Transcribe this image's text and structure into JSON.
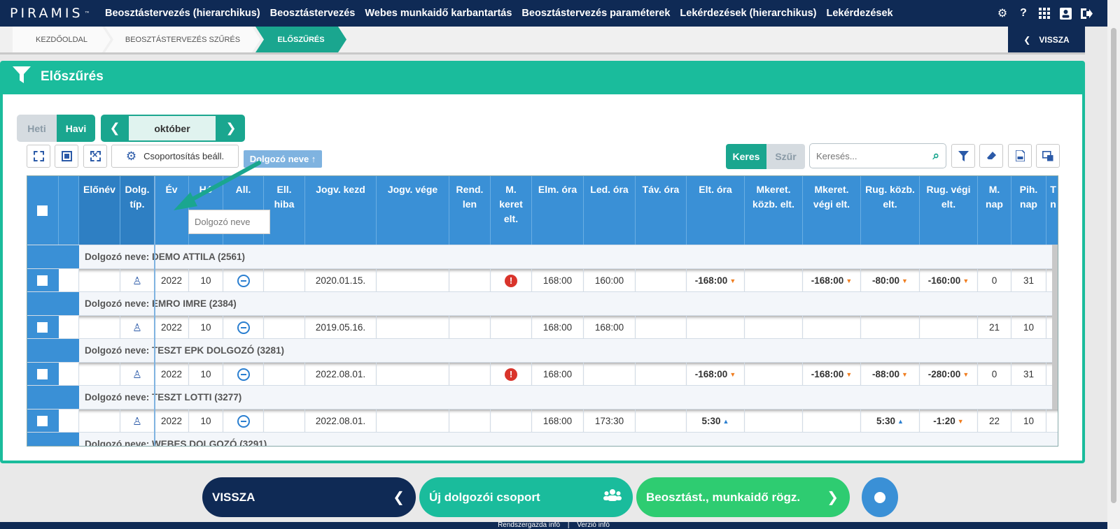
{
  "app": {
    "logo": "PIRAMIS",
    "logo_tm": "™"
  },
  "topnav": [
    "Beosztástervezés (hierarchikus)",
    "Beosztástervezés",
    "Webes munkaidő karbantartás",
    "Beosztástervezés paraméterek",
    "Lekérdezések (hierarchikus)",
    "Lekérdezések"
  ],
  "top_icons": [
    "gear-icon",
    "help-icon",
    "grid-icon",
    "user-card-icon",
    "logout-icon"
  ],
  "breadcrumb": {
    "items": [
      "KEZDŐOLDAL",
      "BEOSZTÁSTERVEZÉS SZŰRÉS",
      "ELŐSZŰRÉS"
    ],
    "back": "VISSZA"
  },
  "panel": {
    "title": "Előszűrés"
  },
  "view": {
    "weekly": "Heti",
    "monthly": "Havi",
    "month": "október"
  },
  "toolbar": {
    "grouping": "Csoportosítás beáll.",
    "drag_chip": "Dolgozó neve ↑",
    "search_btn": "Keres",
    "filter_btn": "Szűr",
    "search_placeholder": "Keresés..."
  },
  "drag_hint": "Dolgozó neve",
  "columns": [
    "Előnév",
    "Dolg. típ.",
    "Év",
    "Hó",
    "All.",
    "Ell. hiba",
    "Jogv. kezd",
    "Jogv. vége",
    "Rend. len",
    "M. keret elt.",
    "Elm. óra",
    "Led. óra",
    "Táv. óra",
    "Elt. óra",
    "Mkeret. közb. elt.",
    "Mkeret. végi elt.",
    "Rug. közb. elt.",
    "Rug. végi elt.",
    "M. nap",
    "Pih. nap",
    "T n"
  ],
  "groups": [
    {
      "label": "Dolgozó neve: DEMO ATTILA (2561)",
      "row": {
        "ev": "2022",
        "ho": "10",
        "jogv_kezd": "2020.01.15.",
        "m_keret": "error",
        "elm": "168:00",
        "led": "160:00",
        "elt": "-168:00",
        "elt_dir": "down",
        "mk_vegi": "-168:00",
        "rug_kozb": "-80:00",
        "rug_vegi": "-160:00",
        "m_nap": "0",
        "pih_nap": "31"
      }
    },
    {
      "label": "Dolgozó neve: EMRO IMRE (2384)",
      "row": {
        "ev": "2022",
        "ho": "10",
        "jogv_kezd": "2019.05.16.",
        "m_keret": "",
        "elm": "168:00",
        "led": "168:00",
        "elt": "",
        "elt_dir": "",
        "mk_vegi": "",
        "rug_kozb": "",
        "rug_vegi": "",
        "m_nap": "21",
        "pih_nap": "10"
      }
    },
    {
      "label": "Dolgozó neve: TESZT EPK DOLGOZÓ (3281)",
      "row": {
        "ev": "2022",
        "ho": "10",
        "jogv_kezd": "2022.08.01.",
        "m_keret": "error",
        "elm": "168:00",
        "led": "",
        "elt": "-168:00",
        "elt_dir": "down",
        "mk_vegi": "-168:00",
        "rug_kozb": "-88:00",
        "rug_vegi": "-280:00",
        "m_nap": "0",
        "pih_nap": "31"
      }
    },
    {
      "label": "Dolgozó neve: TESZT LOTTI (3277)",
      "row": {
        "ev": "2022",
        "ho": "10",
        "jogv_kezd": "2022.08.01.",
        "m_keret": "",
        "elm": "168:00",
        "led": "173:30",
        "elt": "5:30",
        "elt_dir": "up",
        "mk_vegi": "",
        "rug_kozb": "5:30",
        "rug_vegi": "-1:20",
        "m_nap": "22",
        "pih_nap": "10"
      }
    },
    {
      "label": "Dolgozó neve: WEBES DOLGOZÓ (3291)"
    }
  ],
  "bottom": {
    "back": "VISSZA",
    "new_group": "Új dolgozói csoport",
    "schedule": "Beosztást., munkaidő rögz."
  },
  "footer": {
    "admin": "Rendszergazda infó",
    "sep": "|",
    "version": "Verzió infó"
  }
}
